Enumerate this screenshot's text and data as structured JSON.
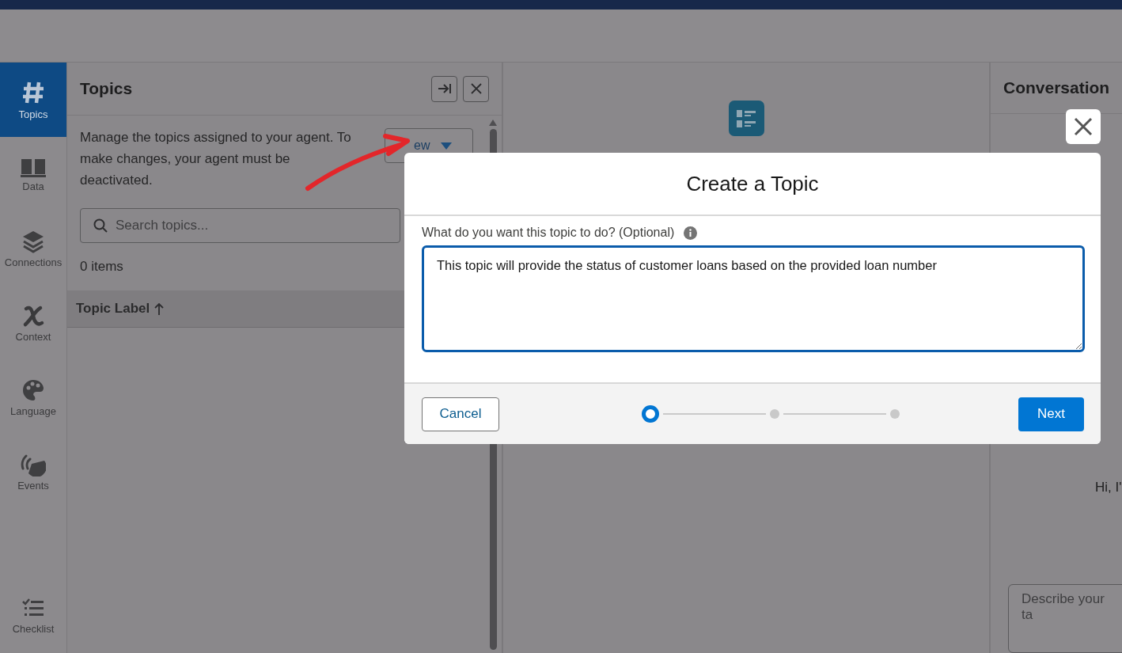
{
  "rail": {
    "items": [
      {
        "label": "Topics",
        "selected": true
      },
      {
        "label": "Data",
        "selected": false
      },
      {
        "label": "Connections",
        "selected": false
      },
      {
        "label": "Context",
        "selected": false
      },
      {
        "label": "Language",
        "selected": false
      },
      {
        "label": "Events",
        "selected": false
      }
    ],
    "footer_item": {
      "label": "Checklist"
    }
  },
  "topics_panel": {
    "title": "Topics",
    "description": "Manage the topics assigned to your agent. To make changes, your agent must be deactivated.",
    "new_button": "ew",
    "search": {
      "placeholder": "Search topics..."
    },
    "count": "0 items",
    "table": {
      "columns": [
        {
          "label": "Topic Label"
        }
      ]
    }
  },
  "conversation_panel": {
    "title": "Conversation",
    "greeting": "Hi, I'",
    "input": {
      "placeholder": "Describe your ta"
    }
  },
  "modal": {
    "title": "Create a Topic",
    "field": {
      "label": "What do you want this topic to do? (Optional)",
      "value": "This topic will provide the status of customer loans based on the provided loan number"
    },
    "steps": [
      {
        "selected": true
      },
      {
        "selected": false
      },
      {
        "selected": false
      }
    ],
    "buttons": {
      "cancel": "Cancel",
      "next": "Next"
    }
  }
}
